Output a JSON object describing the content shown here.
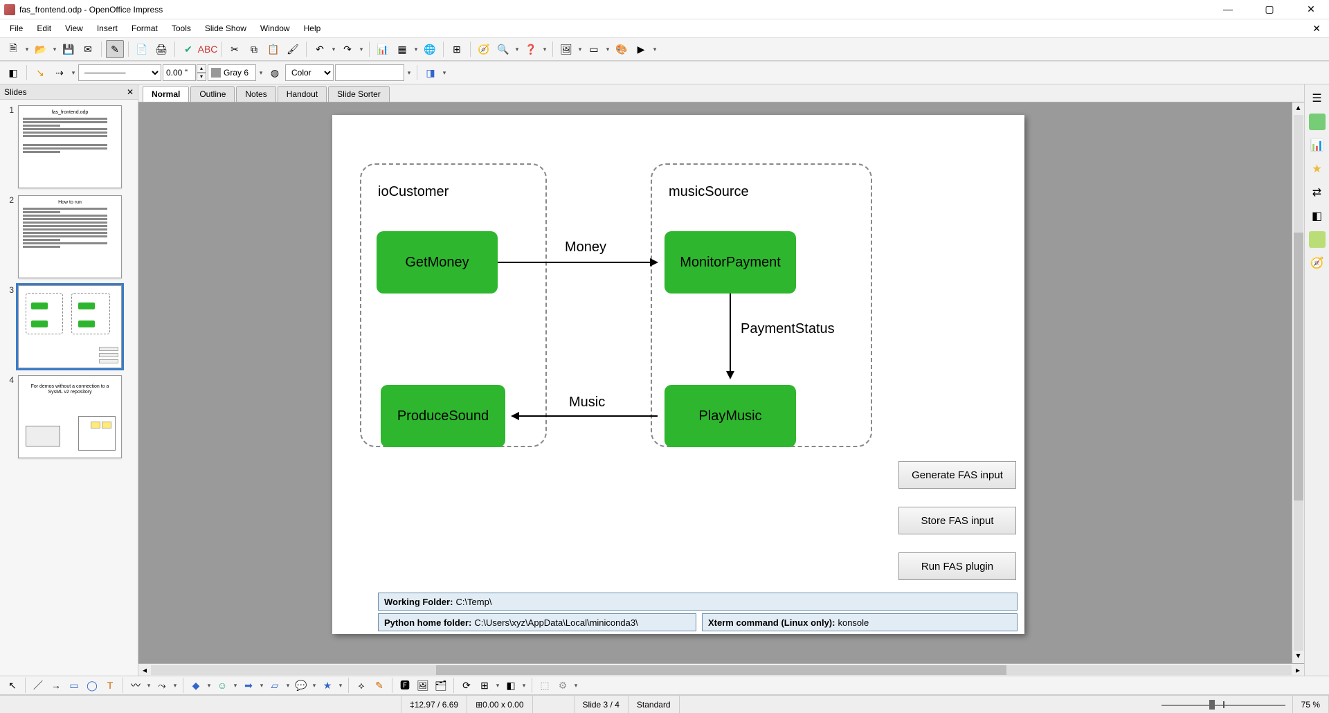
{
  "titlebar": {
    "text": "fas_frontend.odp - OpenOffice Impress"
  },
  "menu": [
    "File",
    "Edit",
    "View",
    "Insert",
    "Format",
    "Tools",
    "Slide Show",
    "Window",
    "Help"
  ],
  "toolbar2": {
    "linewidth": "0.00 \"",
    "linecolor_label": "Gray 6",
    "areastyle": "Color"
  },
  "slides_panel": {
    "title": "Slides"
  },
  "thumbs": [
    {
      "num": "1",
      "title": "fas_frontend.odp"
    },
    {
      "num": "2",
      "title": "How to run"
    },
    {
      "num": "3"
    },
    {
      "num": "4",
      "text": "For demos without a connection to a SysML v2 repository"
    }
  ],
  "view_tabs": [
    "Normal",
    "Outline",
    "Notes",
    "Handout",
    "Slide Sorter"
  ],
  "slide": {
    "group1_label": "ioCustomer",
    "group2_label": "musicSource",
    "box_getmoney": "GetMoney",
    "box_monitor": "MonitorPayment",
    "box_playmusic": "PlayMusic",
    "box_produce": "ProduceSound",
    "edge_money": "Money",
    "edge_paymentstatus": "PaymentStatus",
    "edge_music": "Music",
    "btn_generate": "Generate FAS input",
    "btn_store": "Store FAS input",
    "btn_run": "Run FAS plugin",
    "working_folder_label": "Working Folder:",
    "working_folder_value": "C:\\Temp\\",
    "python_home_label": "Python home folder:",
    "python_home_value": "C:\\Users\\xyz\\AppData\\Local\\miniconda3\\",
    "xterm_label": "Xterm command (Linux only):",
    "xterm_value": "konsole"
  },
  "status": {
    "coords": "12.97 / 6.69",
    "size": "0.00 x 0.00",
    "slide_info": "Slide 3 / 4",
    "mode": "Standard",
    "zoom": "75 %"
  }
}
